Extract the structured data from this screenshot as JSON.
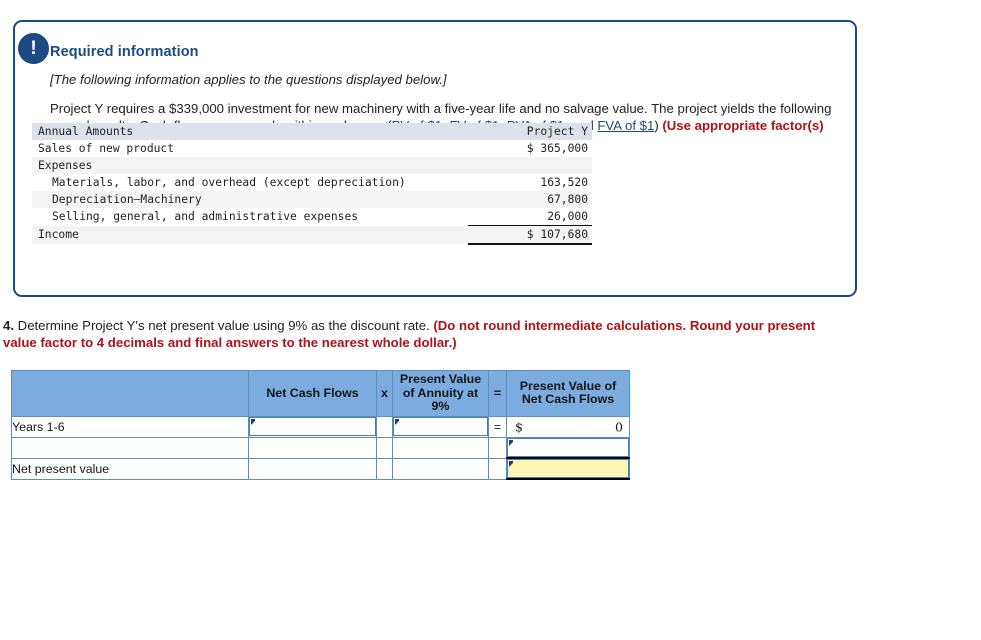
{
  "panel": {
    "badge_icon": "exclamation-icon",
    "badge_glyph": "!",
    "title": "Required information",
    "applies_note": "[The following information applies to the questions displayed below.]",
    "body_part1": "Project Y requires a $339,000 investment for new machinery with a five-year life and no salvage value. The project yields the following annual results. Cash flows occur evenly within each year. (",
    "links": [
      {
        "label": "PV of $1"
      },
      {
        "label": "FV of $1"
      },
      {
        "label": "PVA of $1"
      },
      {
        "label": "FVA of $1"
      }
    ],
    "body_sep1": ", ",
    "body_sep2": ", ",
    "body_sep3": ", and ",
    "body_close": ") ",
    "body_bold_red": "(Use appropriate factor(s) from the tables provided.)"
  },
  "amounts_table": {
    "header": {
      "label": "Annual Amounts",
      "value": "Project Y"
    },
    "rows": [
      {
        "label": "Sales of new product",
        "value": "$ 365,000",
        "indent": false
      },
      {
        "label": "Expenses",
        "value": "",
        "indent": false
      },
      {
        "label": "Materials, labor, and overhead (except depreciation)",
        "value": "163,520",
        "indent": true
      },
      {
        "label": "Depreciation—Machinery",
        "value": "67,800",
        "indent": true
      },
      {
        "label": "Selling, general, and administrative expenses",
        "value": "26,000",
        "indent": true
      },
      {
        "label": "Income",
        "value": "$ 107,680",
        "indent": false
      }
    ]
  },
  "question": {
    "number": "4.",
    "text": " Determine Project Y's net present value using 9% as the discount rate. ",
    "instruction": "(Do not round intermediate calculations. Round your present value factor to 4 decimals and final answers to the nearest whole dollar.)"
  },
  "answer_table": {
    "headers": {
      "blank": "",
      "net_cash_flows": "Net Cash Flows",
      "times": "x",
      "annuity": "Present Value of Annuity at 9%",
      "equals": "=",
      "pv_net_cash": "Present Value of Net Cash Flows"
    },
    "rows": [
      {
        "label": "Years 1-6",
        "net_cash_flows": "",
        "times": "",
        "annuity": "",
        "equals": "=",
        "currency": "$",
        "result": "0"
      },
      {
        "label": "",
        "net_cash_flows": "",
        "times": "",
        "annuity": "",
        "equals": "",
        "result": ""
      },
      {
        "label": "Net present value",
        "result": ""
      }
    ]
  },
  "colors": {
    "panel_border": "#1c4a82",
    "title_blue": "#1c4a82",
    "red": "#b01217",
    "header_blue": "#7babdf",
    "cell_border_blue": "#5b8ec4",
    "yellow_input": "#fcf7b4",
    "table_header_gray": "#dde2e9",
    "table_shade": "#f4f4f4"
  }
}
